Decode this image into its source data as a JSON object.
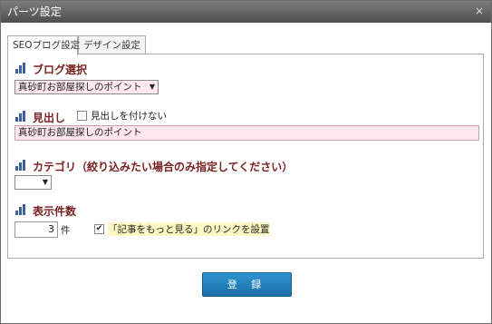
{
  "window": {
    "title": "パーツ設定",
    "close_icon": "×"
  },
  "tabs": [
    {
      "label": "SEOブログ設定",
      "active": true
    },
    {
      "label": "デザイン設定",
      "active": false
    }
  ],
  "blog_select": {
    "heading": "ブログ選択",
    "value": "真砂町お部屋探しのポイント"
  },
  "midashi": {
    "heading": "見出し",
    "no_heading_label": "見出しを付けない",
    "no_heading_checked": false,
    "value": "真砂町お部屋探しのポイント"
  },
  "category": {
    "heading": "カテゴリ（絞り込みたい場合のみ指定してください）",
    "value": ""
  },
  "count": {
    "heading": "表示件数",
    "value": "3",
    "unit": "件",
    "more_link_label": "「記事をもっと見る」のリンクを設置",
    "more_link_checked": true,
    "check_mark": "✔"
  },
  "footer": {
    "register_label": "登 録"
  },
  "colors": {
    "heading": "#7a1f1f",
    "icon": "#3c5f9e",
    "button": "#1f7fbd",
    "input_bg": "#fde6ee",
    "highlight": "#fff8c4"
  }
}
